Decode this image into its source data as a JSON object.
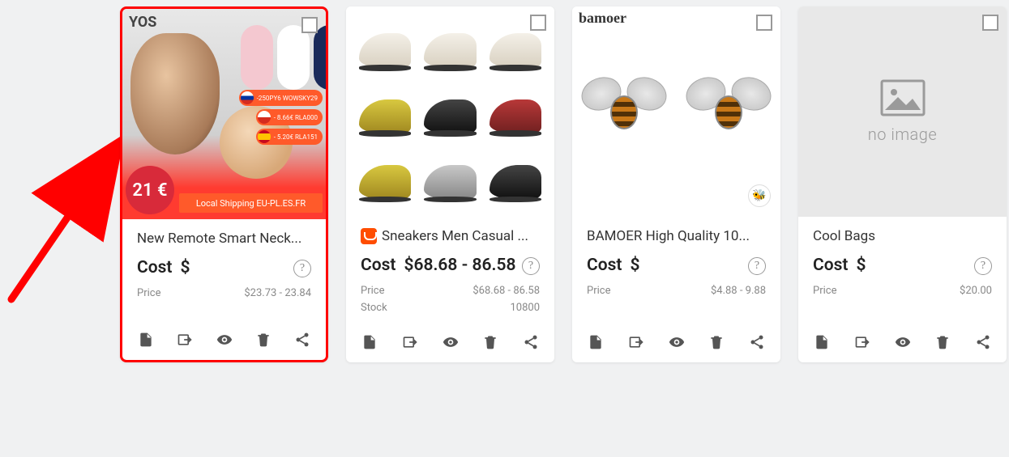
{
  "no_image_label": "no image",
  "labels": {
    "cost": "Cost",
    "price": "Price",
    "stock": "Stock"
  },
  "products": [
    {
      "title": "New Remote Smart Neck...",
      "cost": "$",
      "price": "$23.73 - 23.84",
      "selected": true,
      "thumb": {
        "brand": "YOS",
        "price_circle": "21 €",
        "shipping": "Local Shipping EU-PL.ES.FR",
        "pills": [
          "-250PY6 WOWSKY29",
          "- 8.66€ RLA000",
          "- 5.20€ RLA151"
        ]
      }
    },
    {
      "title": "Sneakers Men Casual ...",
      "cost": "$68.68 - 86.58",
      "price": "$68.68 - 86.58",
      "stock": "10800",
      "ali_badge": true
    },
    {
      "title": "BAMOER High Quality 10...",
      "cost": "$",
      "price": "$4.88 - 9.88",
      "thumb": {
        "logo": "bamoer"
      }
    },
    {
      "title": "Cool Bags",
      "cost": "$",
      "price": "$20.00",
      "no_image": true
    }
  ]
}
